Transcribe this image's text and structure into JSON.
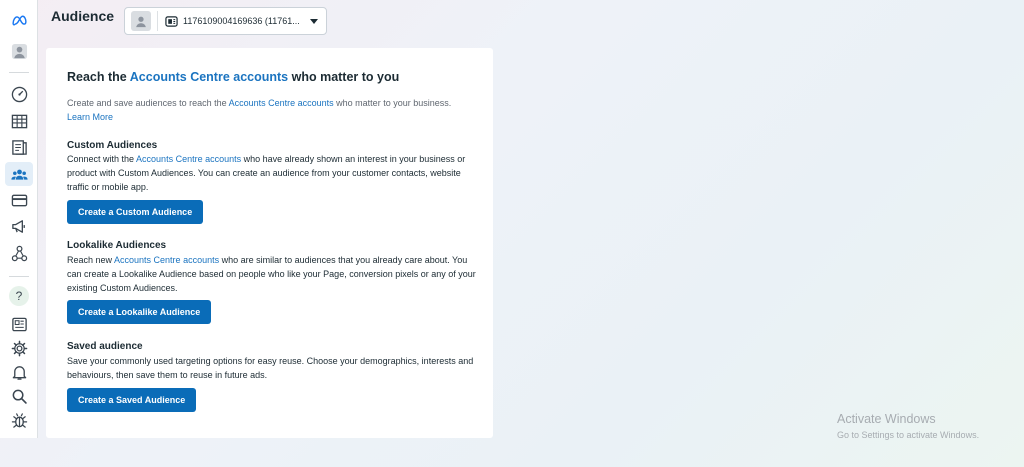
{
  "header": {
    "title": "Audience",
    "account_selector": {
      "value": "1176109004169636 (11761..."
    }
  },
  "sidebar": {
    "items": [
      {
        "name": "meta-logo-icon"
      },
      {
        "name": "profile-avatar-icon"
      },
      {
        "name": "dashboard-icon"
      },
      {
        "name": "table-icon"
      },
      {
        "name": "pages-icon"
      },
      {
        "name": "audience-icon",
        "active": true
      },
      {
        "name": "billing-card-icon"
      },
      {
        "name": "megaphone-icon"
      },
      {
        "name": "connections-icon"
      },
      {
        "name": "help-icon"
      },
      {
        "name": "news-icon"
      },
      {
        "name": "settings-gear-icon"
      },
      {
        "name": "notifications-bell-icon"
      },
      {
        "name": "search-icon"
      },
      {
        "name": "bug-report-icon"
      }
    ]
  },
  "card": {
    "heading_pre": "Reach the ",
    "heading_link": "Accounts Centre accounts",
    "heading_post": " who matter to you",
    "intro_pre": "Create and save audiences to reach the ",
    "intro_link": "Accounts Centre accounts",
    "intro_post": " who matter to your business.",
    "learn_more": "Learn More",
    "custom": {
      "title": "Custom Audiences",
      "desc_pre": "Connect with the ",
      "desc_link": "Accounts Centre accounts",
      "desc_post": " who have already shown an interest in your business or product with Custom Audiences. You can create an audience from your customer contacts, website traffic or mobile app.",
      "button": "Create a Custom Audience"
    },
    "lookalike": {
      "title": "Lookalike Audiences",
      "desc_pre": "Reach new ",
      "desc_link": "Accounts Centre accounts",
      "desc_post": " who are similar to audiences that you already care about. You can create a Lookalike Audience based on people who like your Page, conversion pixels or any of your existing Custom Audiences.",
      "button": "Create a Lookalike Audience"
    },
    "saved": {
      "title": "Saved audience",
      "desc": "Save your commonly used targeting options for easy reuse. Choose your demographics, interests and behaviours, then save them to reuse in future ads.",
      "button": "Create a Saved Audience"
    }
  },
  "watermark": {
    "title": "Activate Windows",
    "subtitle": "Go to Settings to activate Windows."
  },
  "colors": {
    "link": "#1b74c0",
    "button": "#0a6cb8",
    "active_nav": "#e3eef8"
  }
}
